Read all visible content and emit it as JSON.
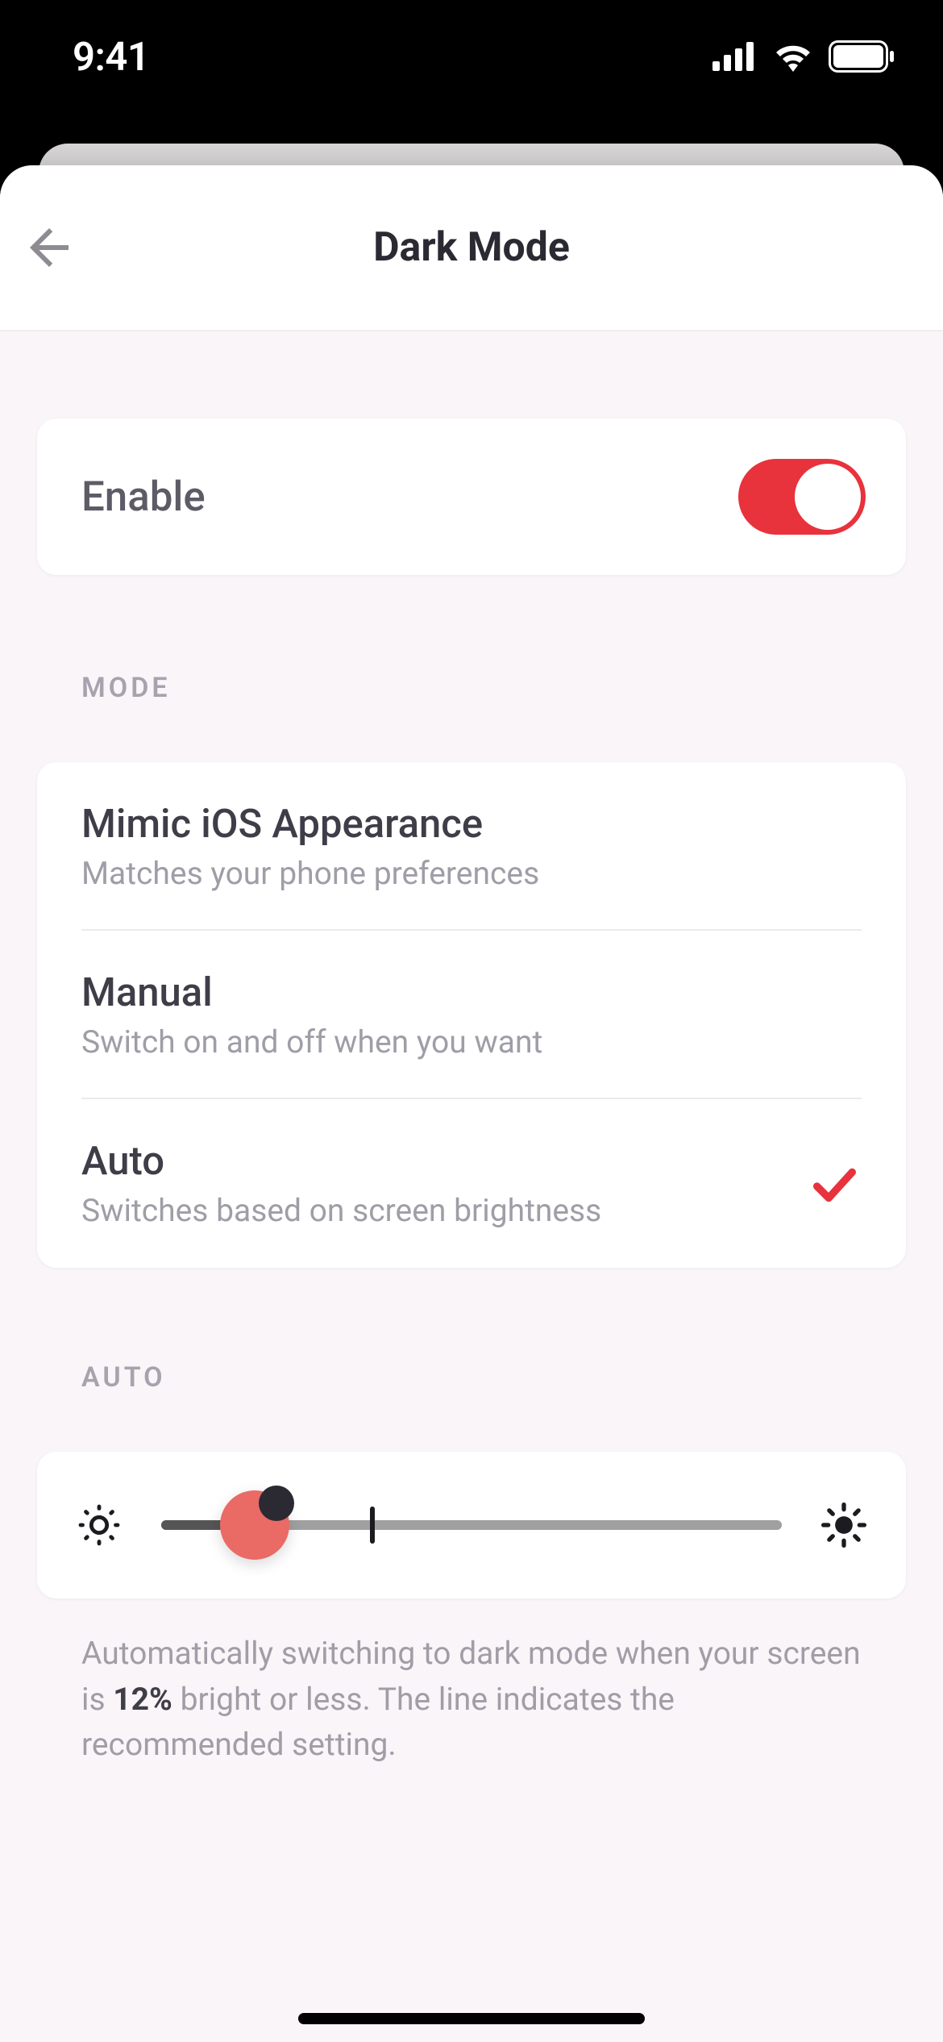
{
  "status_bar": {
    "time": "9:41"
  },
  "header": {
    "title": "Dark Mode"
  },
  "enable": {
    "label": "Enable",
    "on": true
  },
  "sections": {
    "mode_label": "MODE",
    "auto_label": "AUTO"
  },
  "modes": [
    {
      "title": "Mimic iOS Appearance",
      "subtitle": "Matches your phone preferences",
      "selected": false
    },
    {
      "title": "Manual",
      "subtitle": "Switch on and off when you want",
      "selected": false
    },
    {
      "title": "Auto",
      "subtitle": "Switches based on screen brightness",
      "selected": true
    }
  ],
  "auto": {
    "slider_value_percent": 12,
    "recommended_mark_percent": 34,
    "description_pre": "Automatically switching to dark mode when your screen is ",
    "description_bold": "12%",
    "description_post": " bright or less. The line indicates the recommended setting."
  },
  "colors": {
    "accent": "#e8323c",
    "slider_thumb": "#ea6a66"
  }
}
